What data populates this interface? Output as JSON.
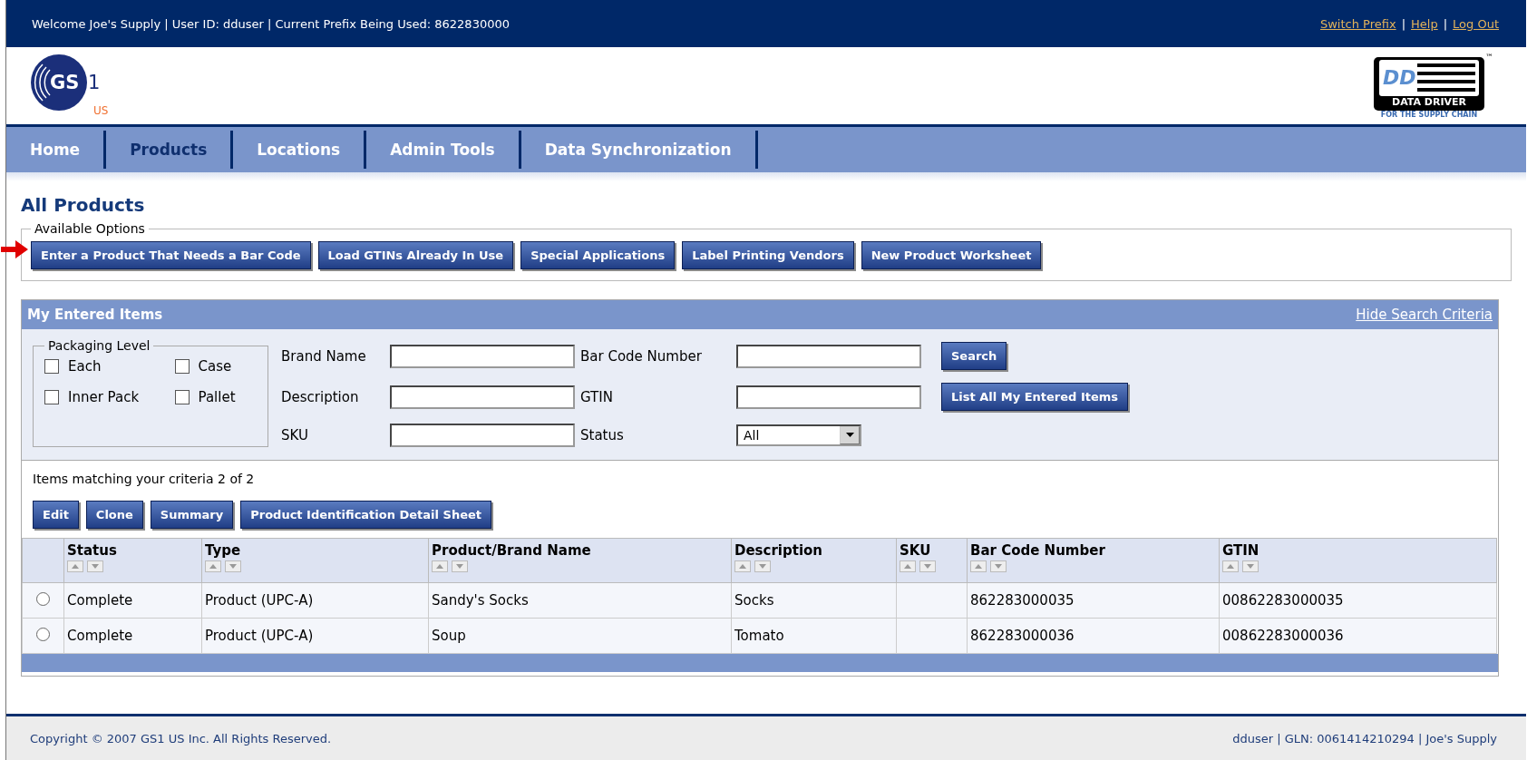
{
  "top_bar": {
    "welcome": "Welcome Joe's Supply | User ID: dduser | Current Prefix Being Used: 8622830000",
    "links": [
      "Switch Prefix",
      "Help",
      "Log Out"
    ],
    "separator": "|"
  },
  "gs1_logo": {
    "mark": "GS",
    "digit": "1",
    "region": "US"
  },
  "data_driver_logo": {
    "letters": "DD",
    "name": "DATA DRIVER",
    "tagline": "FOR THE SUPPLY CHAIN",
    "trademark": "™"
  },
  "nav_tabs": [
    {
      "label": "Home",
      "selected": false
    },
    {
      "label": "Products",
      "selected": true
    },
    {
      "label": "Locations",
      "selected": false
    },
    {
      "label": "Admin Tools",
      "selected": false
    },
    {
      "label": "Data Synchronization",
      "selected": false
    }
  ],
  "page_title": "All Products",
  "available_options": {
    "legend": "Available Options",
    "buttons": [
      "Enter a Product That Needs a Bar Code",
      "Load GTINs Already In Use",
      "Special Applications",
      "Label Printing Vendors",
      "New Product Worksheet"
    ]
  },
  "panel": {
    "title": "My Entered Items",
    "toggle_link": "Hide Search Criteria",
    "packaging_level": {
      "legend": "Packaging Level",
      "options": [
        {
          "label": "Each",
          "checked": false
        },
        {
          "label": "Case",
          "checked": false
        },
        {
          "label": "Inner Pack",
          "checked": false
        },
        {
          "label": "Pallet",
          "checked": false
        }
      ]
    },
    "fields": [
      {
        "label": "Brand Name",
        "kind": "text"
      },
      {
        "label": "Bar Code Number",
        "kind": "text"
      },
      {
        "label": "Description",
        "kind": "text"
      },
      {
        "label": "GTIN",
        "kind": "text"
      },
      {
        "label": "SKU",
        "kind": "text"
      },
      {
        "label": "Status",
        "kind": "select",
        "value": "All"
      }
    ],
    "search_buttons": [
      "Search",
      "List All My Entered Items"
    ],
    "result_count": "Items matching your criteria 2 of 2",
    "action_buttons": [
      "Edit",
      "Clone",
      "Summary",
      "Product Identification Detail Sheet"
    ],
    "table": {
      "columns": [
        "Status",
        "Type",
        "Product/Brand Name",
        "Description",
        "SKU",
        "Bar Code Number",
        "GTIN"
      ],
      "rows": [
        {
          "selected": false,
          "cells": [
            "Complete",
            "Product (UPC-A)",
            "Sandy's Socks",
            "Socks",
            "",
            "862283000035",
            "00862283000035"
          ]
        },
        {
          "selected": false,
          "cells": [
            "Complete",
            "Product (UPC-A)",
            "Soup",
            "Tomato",
            "",
            "862283000036",
            "00862283000036"
          ]
        }
      ]
    }
  },
  "footer": {
    "copyright": "Copyright © 2007 GS1 US Inc. All Rights Reserved.",
    "account": "dduser | GLN: 0061414210294 | Joe's Supply"
  }
}
